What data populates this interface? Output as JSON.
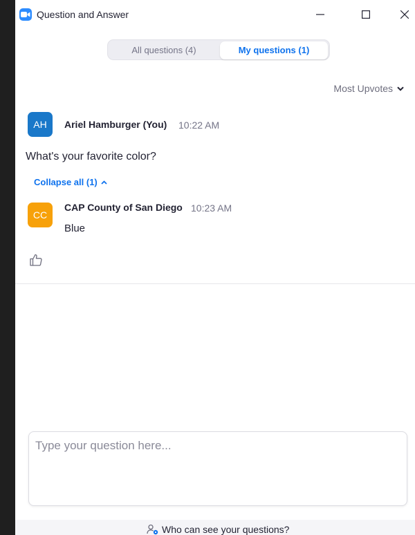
{
  "window": {
    "title": "Question and Answer"
  },
  "tabs": {
    "all_label": "All questions (4)",
    "mine_label": "My questions (1)",
    "active": "mine"
  },
  "sort": {
    "label": "Most Upvotes"
  },
  "question": {
    "avatar_initials": "AH",
    "avatar_color": "#1a78c9",
    "author": "Ariel Hamburger (You)",
    "time": "10:22 AM",
    "text": "What's your favorite color?",
    "collapse_label": "Collapse all (1)"
  },
  "answer": {
    "avatar_initials": "CC",
    "avatar_color": "#f7a10a",
    "author": "CAP County of San Diego",
    "time": "10:23 AM",
    "text": "Blue"
  },
  "composer": {
    "placeholder": "Type your question here..."
  },
  "footer": {
    "who_label": "Who can see your questions?"
  },
  "colors": {
    "accent": "#0e72ed",
    "zoom_blue": "#2d8cff"
  },
  "icons": {
    "app": "zoom-camera-icon",
    "sort": "chevron-down-icon",
    "collapse": "chevron-up-icon",
    "like": "thumbs-up-icon",
    "who": "user-eye-icon"
  }
}
